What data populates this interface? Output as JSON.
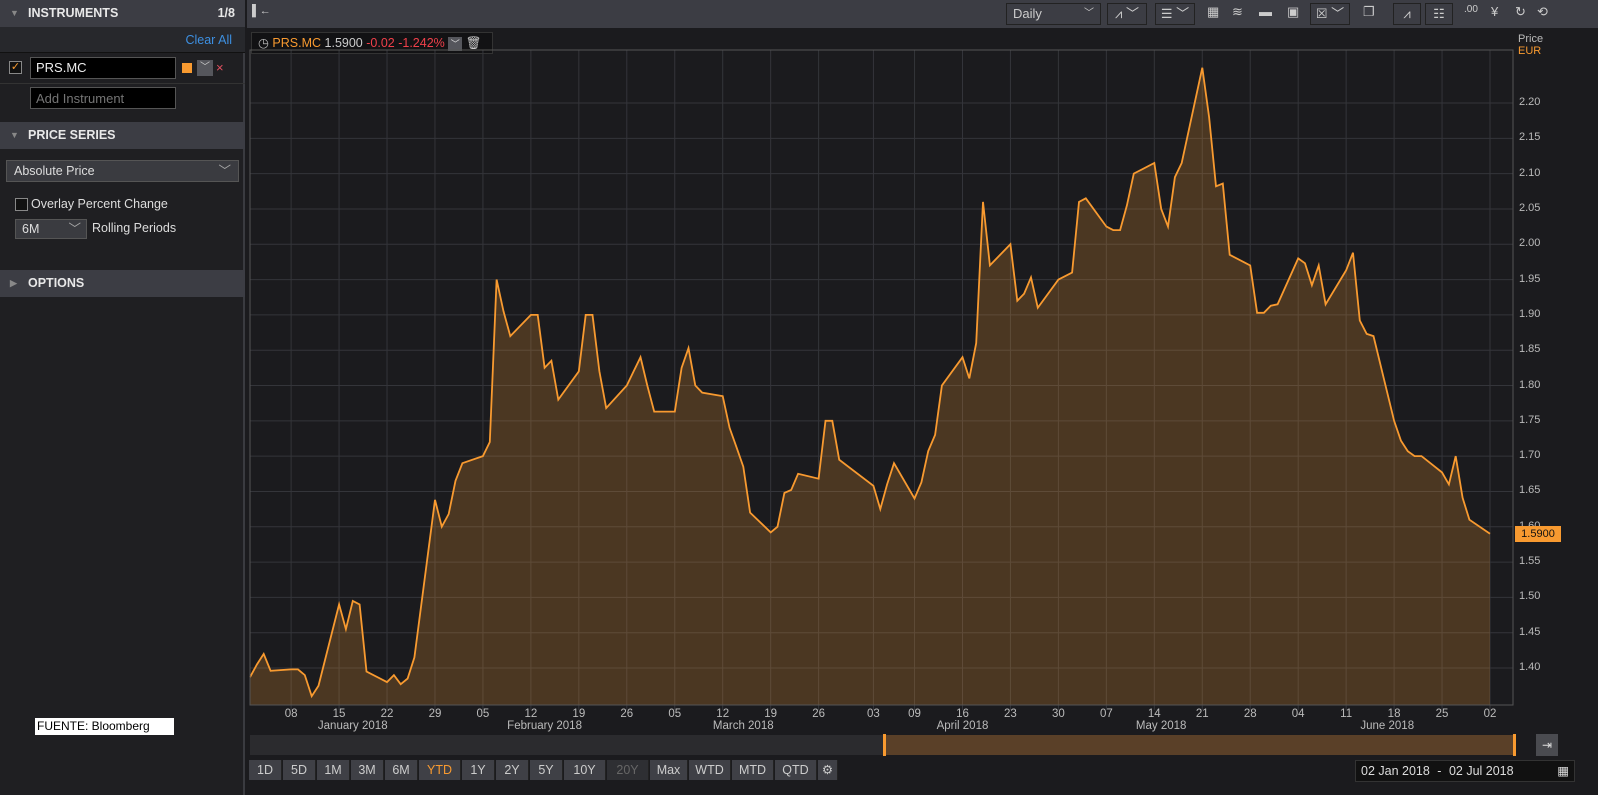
{
  "sidebar": {
    "instruments_title": "INSTRUMENTS",
    "instruments_count": "1/8",
    "clear_all": "Clear All",
    "instrument": "PRS.MC",
    "instrument_color": "#f89a30",
    "add_placeholder": "Add Instrument",
    "price_series_title": "PRICE SERIES",
    "price_type": "Absolute Price",
    "overlay_label": "Overlay Percent Change",
    "rolling_value": "6M",
    "rolling_label": "Rolling Periods",
    "options_title": "OPTIONS"
  },
  "toolbar": {
    "interval": "Daily"
  },
  "legend": {
    "ticker": "PRS.MC",
    "price": "1.5900",
    "change": "-0.02",
    "pct": "-1.242%"
  },
  "axis": {
    "price_label": "Price",
    "currency": "EUR",
    "last_tag": "1.5900"
  },
  "ranges": [
    "1D",
    "5D",
    "1M",
    "3M",
    "6M",
    "YTD",
    "1Y",
    "2Y",
    "5Y",
    "10Y",
    "20Y",
    "Max",
    "WTD",
    "MTD",
    "QTD"
  ],
  "active_range": "YTD",
  "date_from": "02 Jan 2018",
  "date_sep": "-",
  "date_to": "02 Jul 2018",
  "source_note": "FUENTE: Bloomberg",
  "chart_data": {
    "type": "area",
    "title": "PRS.MC",
    "ylabel": "Price EUR",
    "ylim": [
      1.35,
      2.27
    ],
    "yticks": [
      "1.40",
      "1.45",
      "1.50",
      "1.55",
      "1.60",
      "1.65",
      "1.70",
      "1.75",
      "1.80",
      "1.85",
      "1.90",
      "1.95",
      "2.00",
      "2.05",
      "2.10",
      "2.15",
      "2.20"
    ],
    "xrange": [
      "2018-01-02",
      "2018-07-02"
    ],
    "week_ticks": [
      [
        "2018-01-08",
        "08"
      ],
      [
        "2018-01-15",
        "15"
      ],
      [
        "2018-01-22",
        "22"
      ],
      [
        "2018-01-29",
        "29"
      ],
      [
        "2018-02-05",
        "05"
      ],
      [
        "2018-02-12",
        "12"
      ],
      [
        "2018-02-19",
        "19"
      ],
      [
        "2018-02-26",
        "26"
      ],
      [
        "2018-03-05",
        "05"
      ],
      [
        "2018-03-12",
        "12"
      ],
      [
        "2018-03-19",
        "19"
      ],
      [
        "2018-03-26",
        "26"
      ],
      [
        "2018-04-03",
        "03"
      ],
      [
        "2018-04-09",
        "09"
      ],
      [
        "2018-04-16",
        "16"
      ],
      [
        "2018-04-23",
        "23"
      ],
      [
        "2018-04-30",
        "30"
      ],
      [
        "2018-05-07",
        "07"
      ],
      [
        "2018-05-14",
        "14"
      ],
      [
        "2018-05-21",
        "21"
      ],
      [
        "2018-05-28",
        "28"
      ],
      [
        "2018-06-04",
        "04"
      ],
      [
        "2018-06-11",
        "11"
      ],
      [
        "2018-06-18",
        "18"
      ],
      [
        "2018-06-25",
        "25"
      ],
      [
        "2018-07-02",
        "02"
      ]
    ],
    "months": [
      [
        "2018-01-17",
        "January 2018"
      ],
      [
        "2018-02-14",
        "February 2018"
      ],
      [
        "2018-03-15",
        "March 2018"
      ],
      [
        "2018-04-16",
        "April 2018"
      ],
      [
        "2018-05-15",
        "May 2018"
      ],
      [
        "2018-06-17",
        "June 2018"
      ]
    ],
    "grid": true,
    "trading_days_from": "2018-01-02",
    "holidays": [
      "2018-03-30",
      "2018-04-02",
      "2018-05-01"
    ],
    "values": [
      1.387,
      1.405,
      1.42,
      1.396,
      1.398,
      1.398,
      1.39,
      1.36,
      1.375,
      1.49,
      1.455,
      1.495,
      1.49,
      1.395,
      1.38,
      1.39,
      1.377,
      1.385,
      1.415,
      1.638,
      1.6,
      1.618,
      1.665,
      1.69,
      1.7,
      1.72,
      1.95,
      1.905,
      1.87,
      1.9,
      1.9,
      1.825,
      1.835,
      1.78,
      1.82,
      1.9,
      1.9,
      1.82,
      1.768,
      1.8,
      1.82,
      1.84,
      1.8,
      1.763,
      1.763,
      1.825,
      1.853,
      1.8,
      1.79,
      1.785,
      1.74,
      1.713,
      1.685,
      1.62,
      1.592,
      1.6,
      1.648,
      1.652,
      1.675,
      1.668,
      1.75,
      1.75,
      1.695,
      1.658,
      1.625,
      1.66,
      1.69,
      1.64,
      1.663,
      1.707,
      1.73,
      1.8,
      1.84,
      1.81,
      1.86,
      2.06,
      1.97,
      2.0,
      1.92,
      1.93,
      1.953,
      1.91,
      1.95,
      1.96,
      2.06,
      2.065,
      2.025,
      2.02,
      2.02,
      2.055,
      2.1,
      2.115,
      2.05,
      2.025,
      2.095,
      2.115,
      2.25,
      2.18,
      2.082,
      2.086,
      1.985,
      1.97,
      1.903,
      1.903,
      1.913,
      1.915,
      1.98,
      1.973,
      1.942,
      1.97,
      1.915,
      1.963,
      1.988,
      1.892,
      1.873,
      1.87,
      1.75,
      1.722,
      1.707,
      1.7,
      1.7,
      1.677,
      1.66,
      1.7,
      1.641,
      1.61,
      1.59
    ],
    "line_color": "#f89a30"
  }
}
